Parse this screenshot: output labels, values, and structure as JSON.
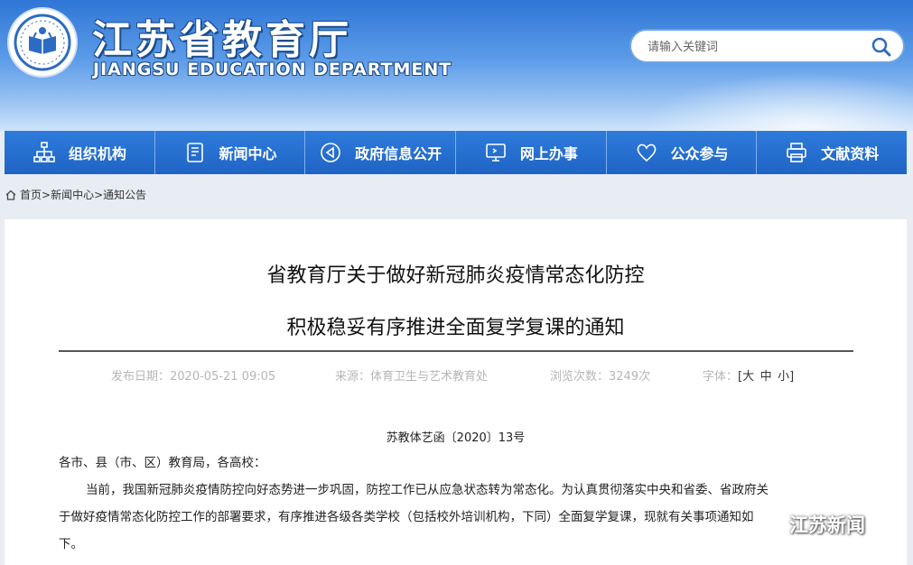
{
  "header": {
    "title": "江苏省教育厅",
    "subtitle": "JIANGSU EDUCATION DEPARTMENT",
    "search_placeholder": "请输入关键词"
  },
  "nav": [
    {
      "label": "组织机构",
      "icon": "org-chart-icon"
    },
    {
      "label": "新闻中心",
      "icon": "document-icon"
    },
    {
      "label": "政府信息公开",
      "icon": "speaker-icon"
    },
    {
      "label": "网上办事",
      "icon": "monitor-icon"
    },
    {
      "label": "公众参与",
      "icon": "heart-icon"
    },
    {
      "label": "文献资料",
      "icon": "printer-icon"
    }
  ],
  "breadcrumb": {
    "items": [
      "首页",
      "新闻中心",
      "通知公告"
    ],
    "separator": ">"
  },
  "article": {
    "title_line1": "省教育厅关于做好新冠肺炎疫情常态化防控",
    "title_line2": "积极稳妥有序推进全面复学复课的通知",
    "publish_date": "发布日期：2020-05-21 09:05",
    "source": "来源：体育卫生与艺术教育处",
    "views": "浏览次数：3249次",
    "font_label": "字体：",
    "font_sizes": [
      "大",
      "中",
      "小"
    ],
    "doc_number": "苏教体艺函〔2020〕13号",
    "salutation": "各市、县（市、区）教育局，各高校：",
    "para1_line1": "当前，我国新冠肺炎疫情防控向好态势进一步巩固，防控工作已从应急状态转为常态化。为认真贯彻落实中央和省委、省政府关",
    "para1_line2": "于做好疫情常态化防控工作的部署要求，有序推进各级各类学校（包括校外培训机构，下同）全面复学复课，现就有关事项通知如",
    "para1_line3": "下。"
  },
  "watermark": "江苏新闻",
  "colors": {
    "nav": "#1f64c4",
    "header_top": "#2f76d6"
  }
}
